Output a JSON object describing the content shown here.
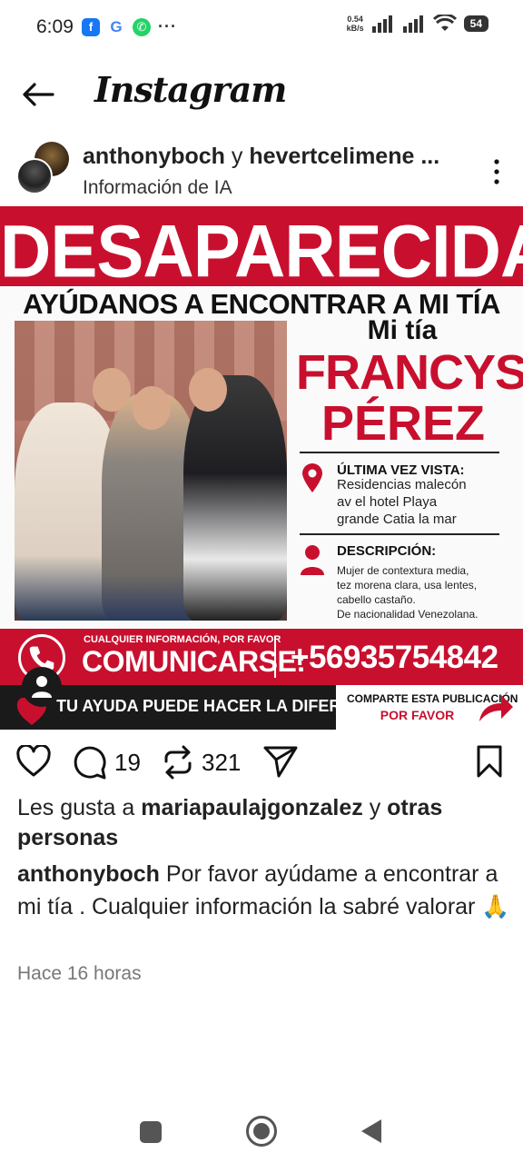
{
  "status_bar": {
    "time": "6:09",
    "apps": [
      {
        "icon": "facebook-icon",
        "glyph": "f"
      },
      {
        "icon": "google-icon",
        "glyph": "G"
      },
      {
        "icon": "whatsapp-icon",
        "glyph": "✆"
      }
    ],
    "more": "···",
    "net_speed_value": "0.54",
    "net_speed_unit": "kB/s",
    "battery": "54"
  },
  "header": {
    "logo": "Instagram"
  },
  "post": {
    "user_primary": "anthonyboch",
    "user_conj": " y ",
    "user_secondary": "hevertcelimene ...",
    "subtitle": "Información de IA"
  },
  "flyer": {
    "title": "DESAPARECIDA",
    "subtitle": "AYÚDANOS A ENCONTRAR A MI TÍA",
    "name_prefix": "Mi tía",
    "name_first": "FRANCYS",
    "name_last": "PÉREZ",
    "last_seen_label": "ÚLTIMA VEZ VISTA:",
    "last_seen_text": "Residencias malecón\nav el hotel Playa\ngrande Catia la mar",
    "description_label": "DESCRIPCIÓN:",
    "description_text": "Mujer de contextura media,\ntez morena clara, usa lentes,\ncabello castaño.\nDe nacionalidad Venezolana.",
    "contact_small": "CUALQUIER INFORMACIÓN, POR FAVOR",
    "contact_big": "COMUNICARSE:",
    "phone": "+56935754842",
    "help_text": "TU AYUDA PUEDE HACER LA DIFERENCIA",
    "share_line1": "COMPARTE ESTA PUBLICACIÓN",
    "share_line2": "POR FAVOR"
  },
  "actions": {
    "comments": "19",
    "reposts": "321"
  },
  "likes": {
    "prefix": "Les gusta a ",
    "user": "mariapaulajgonzalez",
    "mid": " y ",
    "others": "otras personas"
  },
  "caption": {
    "user": "anthonyboch",
    "text": " Por favor ayúdame a encontrar a mi tía . Cualquier información la sabré valorar 🙏"
  },
  "timestamp": "Hace 16 horas",
  "colors": {
    "flyer_red": "#c8102e",
    "flyer_dark": "#1a1a1a"
  }
}
